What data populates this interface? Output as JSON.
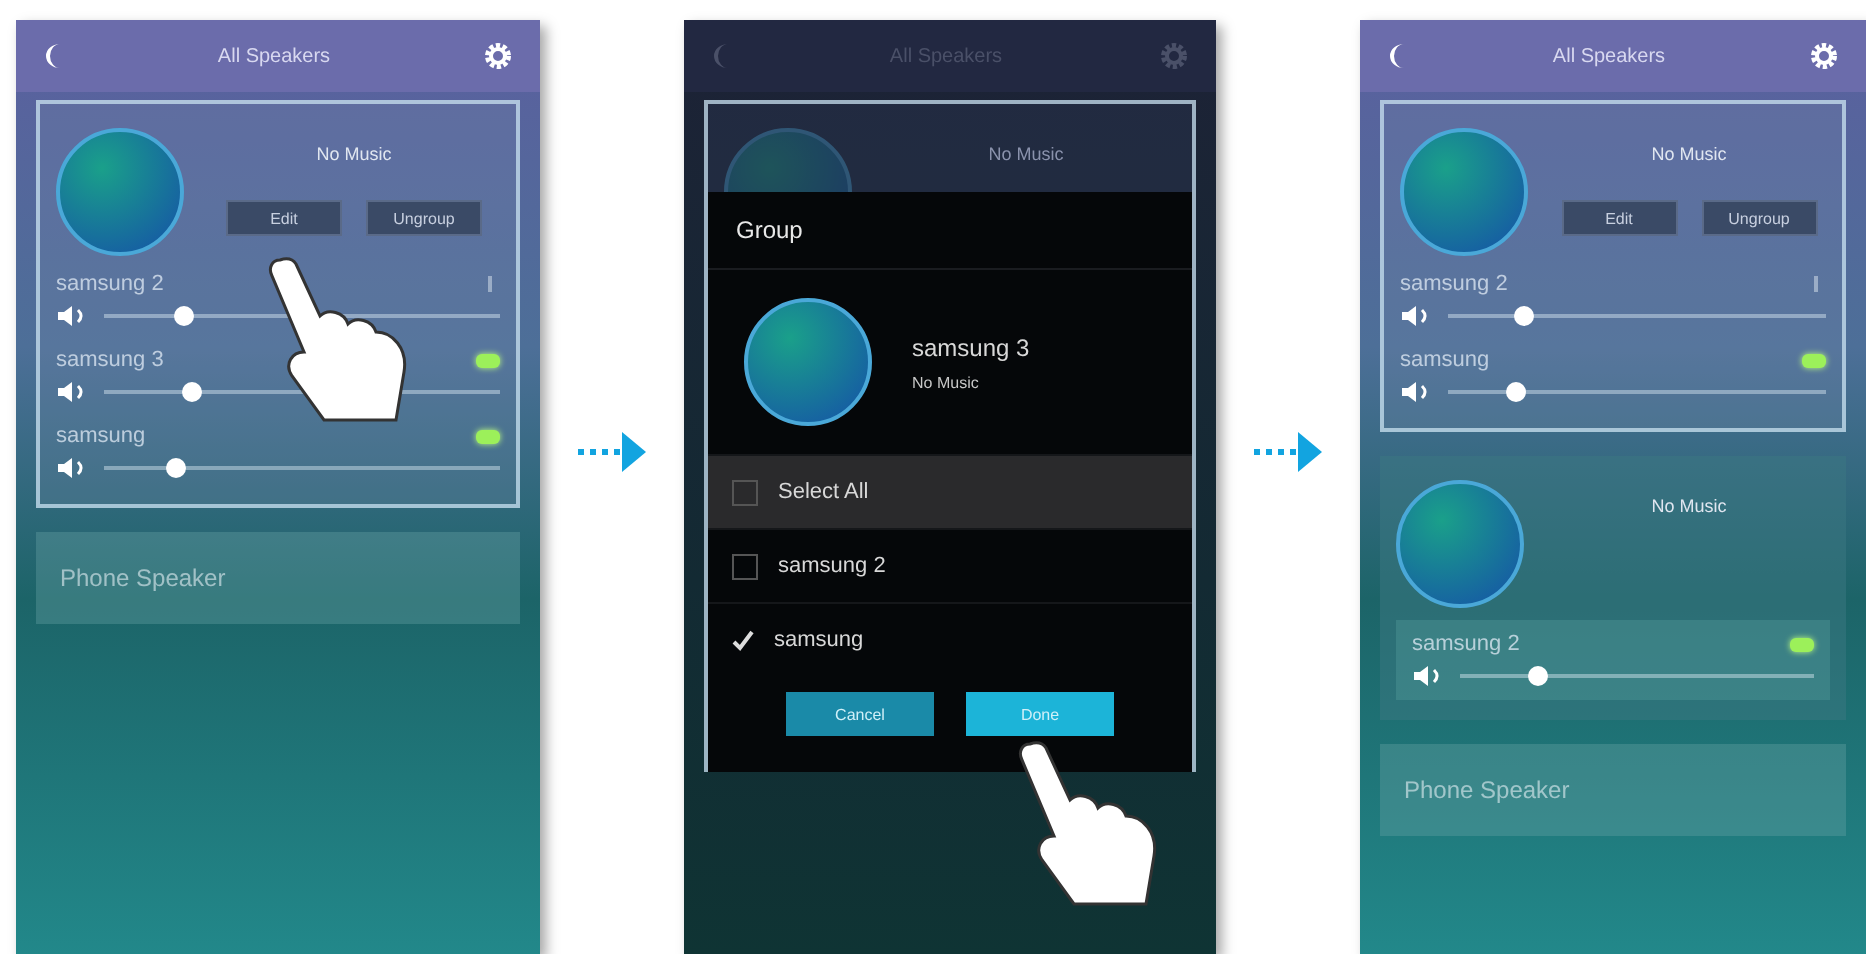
{
  "screens": [
    {
      "kind": "list",
      "header": {
        "title": "All Speakers"
      },
      "groups": [
        {
          "title": "No Music",
          "highlighted": true,
          "buttons": [
            "Edit",
            "Ungroup"
          ],
          "speakers": [
            {
              "name": "samsung 2",
              "active": false,
              "level": 0.2
            },
            {
              "name": "samsung 3",
              "active": true,
              "level": 0.22
            },
            {
              "name": "samsung",
              "active": true,
              "level": 0.18
            }
          ]
        }
      ],
      "phone_speaker": "Phone Speaker"
    },
    {
      "kind": "dialog",
      "header": {
        "title": "All Speakers"
      },
      "background_group": {
        "title": "No Music"
      },
      "dialog": {
        "title": "Group",
        "speaker": "samsung 3",
        "status": "No Music",
        "options": [
          {
            "label": "Select All",
            "checked": false,
            "selected": true
          },
          {
            "label": "samsung 2",
            "checked": false,
            "selected": false
          },
          {
            "label": "samsung",
            "checked": true,
            "selected": false
          }
        ],
        "buttons": [
          {
            "label": "Cancel",
            "selected": false
          },
          {
            "label": "Done",
            "selected": true
          }
        ]
      }
    },
    {
      "kind": "list",
      "header": {
        "title": "All Speakers"
      },
      "groups": [
        {
          "title": "No Music",
          "highlighted": true,
          "buttons": [
            "Edit",
            "Ungroup"
          ],
          "speakers": [
            {
              "name": "samsung 2",
              "active": false,
              "level": 0.2
            },
            {
              "name": "samsung",
              "active": true,
              "level": 0.18
            }
          ]
        },
        {
          "title": "No Music",
          "highlighted": false,
          "speakers": [
            {
              "name": "samsung 2",
              "active": true,
              "level": 0.22
            }
          ]
        }
      ],
      "phone_speaker": "Phone Speaker"
    }
  ]
}
